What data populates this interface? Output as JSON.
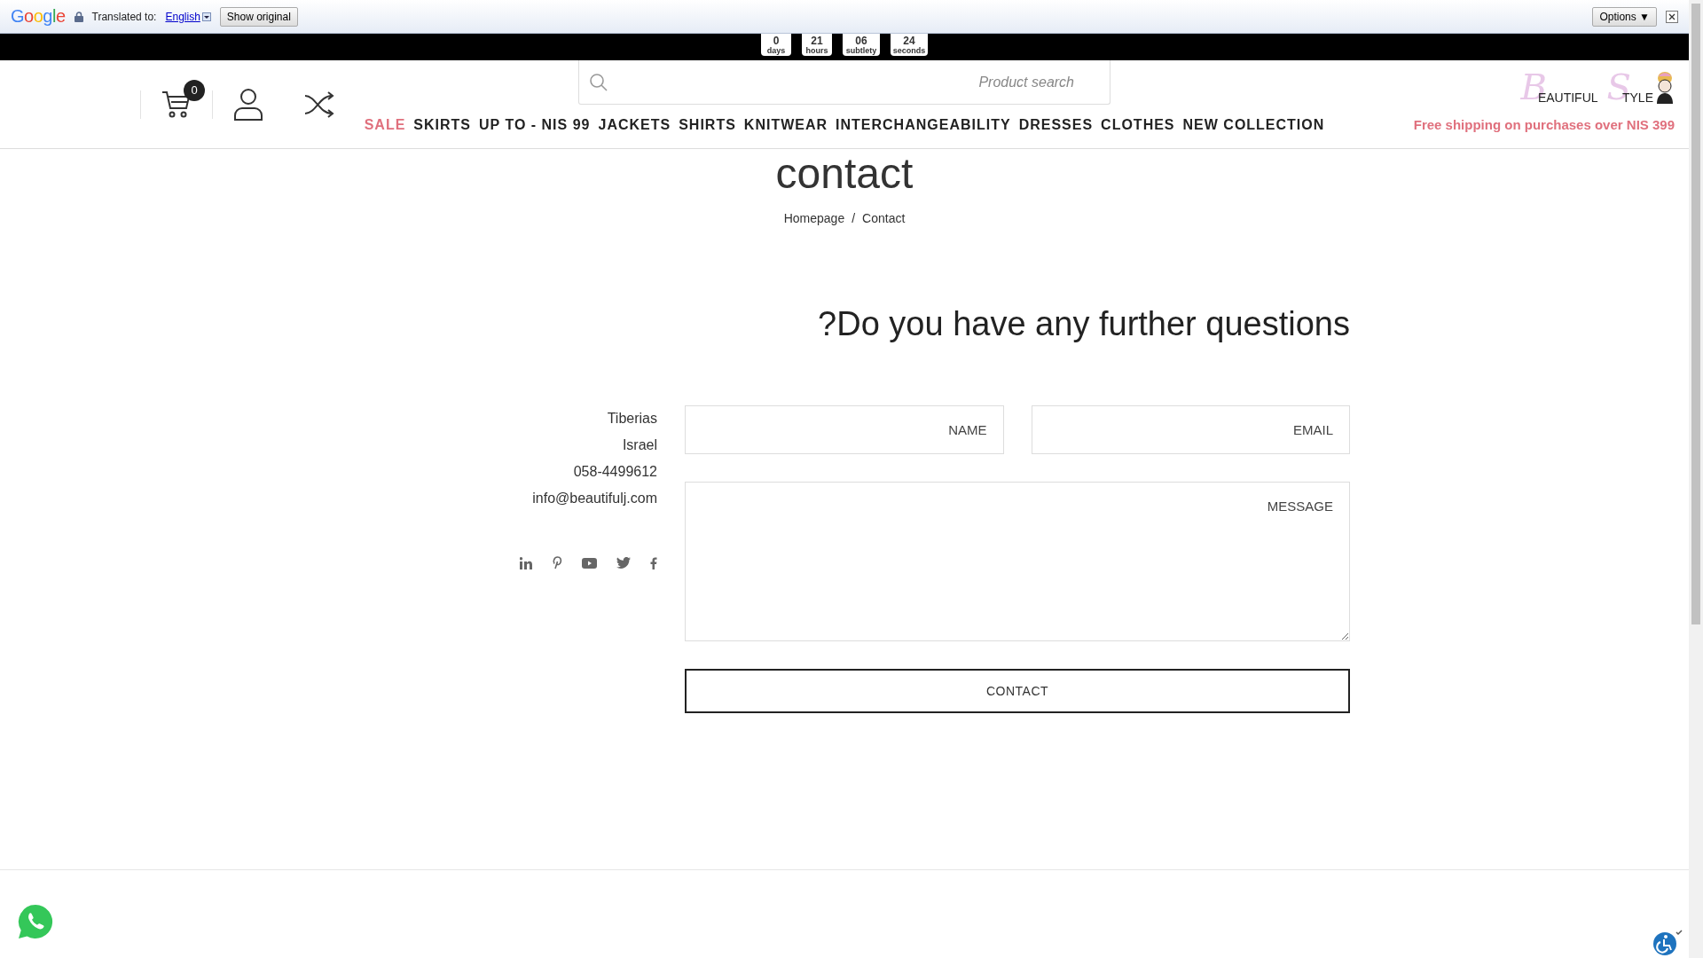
{
  "translate_bar": {
    "brand": "Google",
    "label": "Translated to:",
    "language": "English",
    "show_original": "Show original",
    "options": "Options ▼"
  },
  "countdown": [
    {
      "value": "0",
      "unit": "days"
    },
    {
      "value": "21",
      "unit": "hours"
    },
    {
      "value": "06",
      "unit": "subtlety"
    },
    {
      "value": "24",
      "unit": "seconds"
    }
  ],
  "header": {
    "cart_count": "0",
    "search": {
      "placeholder": "Product search"
    },
    "nav": [
      {
        "label": "SALE",
        "kind": "sale"
      },
      {
        "label": "SKIRTS",
        "kind": "normal"
      },
      {
        "label": "UP TO - NIS 99",
        "kind": "normal"
      },
      {
        "label": "JACKETS",
        "kind": "normal"
      },
      {
        "label": "SHIRTS",
        "kind": "normal"
      },
      {
        "label": "KNITWEAR",
        "kind": "normal"
      },
      {
        "label": "INTERCHANGEABILITY",
        "kind": "normal"
      },
      {
        "label": "DRESSES",
        "kind": "normal"
      },
      {
        "label": "CLOTHES",
        "kind": "normal"
      },
      {
        "label": "NEW COLLECTION",
        "kind": "normal"
      }
    ],
    "logo": {
      "initial_1": "B",
      "rest_1": "EAUTIFUL",
      "initial_2": "S",
      "rest_2": "TYLE"
    },
    "shipping_note": "Free shipping on purchases over NIS 399"
  },
  "page": {
    "title": "contact",
    "breadcrumb": [
      "Homepage",
      "Contact"
    ],
    "separator": "/"
  },
  "contact": {
    "heading": "?Do you have any further questions",
    "info": [
      "Tiberias",
      "Israel",
      "058-4499612",
      "info@beautifulj.com"
    ],
    "name_field": {
      "placeholder": "NAME"
    },
    "email_field": {
      "placeholder": "EMAIL"
    },
    "message_field": {
      "placeholder": "MESSAGE"
    },
    "submit": "CONTACT"
  }
}
